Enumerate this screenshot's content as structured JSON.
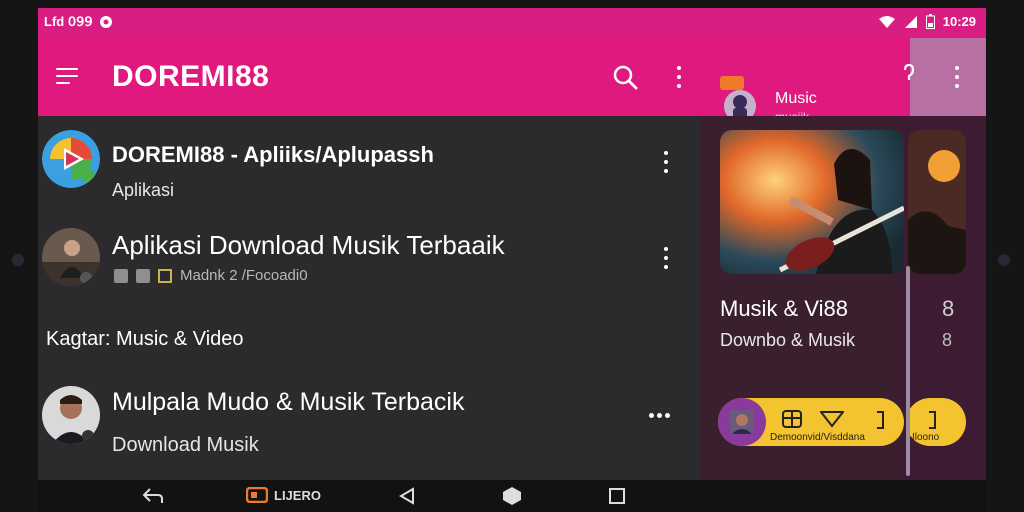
{
  "status": {
    "left_text": "Lfd 𝟢𝟫𝟫",
    "time": "10:29"
  },
  "appbar": {
    "title": "DOREMI88",
    "music_label": "Music",
    "music_sub": "musiik"
  },
  "list": {
    "items": [
      {
        "title": "DOREMI88 - Apliiks/Aplupassh",
        "subtitle": "Aplikasi"
      },
      {
        "title": "Aplikasi Download Musik Terbaaik",
        "subtitle": "Madnk 2 /Focoadi0"
      },
      {
        "category": "Kagtar: Music & Video"
      },
      {
        "title": "Mulpala Mudo & Musik Terbacik",
        "subtitle": "Download Musik"
      }
    ]
  },
  "side": {
    "card_title": "Musik & Vi88",
    "card_sub": "Downbo & Musik",
    "card_title_peek": "8",
    "card_sub_peek": "8",
    "pill_label": "Demoonvid/Visddana",
    "pill_label_peek": "Iloono"
  },
  "navbar": {
    "app_label": "LIJERO"
  },
  "colors": {
    "appbar": "#e0197f",
    "statusbar": "#d81e82",
    "list_bg": "#2b2b2d",
    "side_panel": "#3a1f2f",
    "pill": "#f4c430"
  },
  "icons": [
    "menu-icon",
    "search-icon",
    "more-vert-icon",
    "music-app-icon",
    "wifi-icon",
    "signal-icon",
    "battery-icon",
    "back-icon",
    "home-icon",
    "recents-icon"
  ]
}
